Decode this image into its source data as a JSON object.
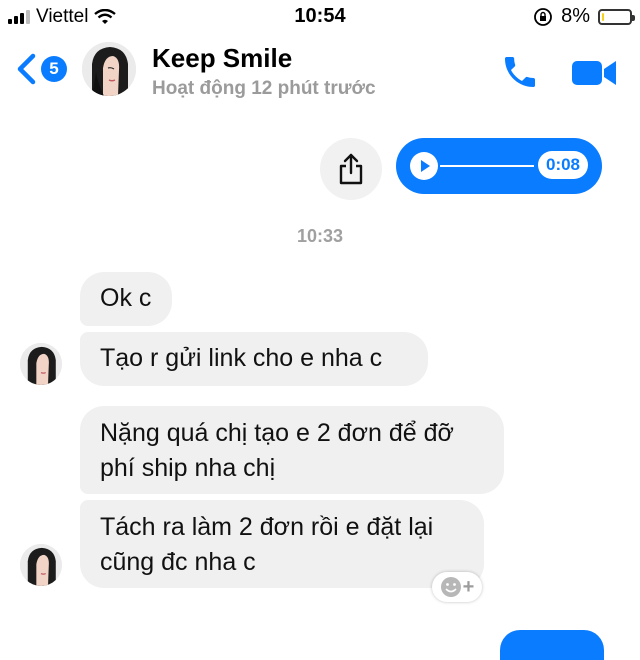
{
  "status_bar": {
    "carrier": "Viettel",
    "time": "10:54",
    "battery": "8%",
    "battery_level": 0.08,
    "icons": [
      "signal-icon",
      "wifi-icon",
      "orientation-lock-icon",
      "battery-icon"
    ]
  },
  "header": {
    "back_count": "5",
    "contact_name": "Keep Smile",
    "contact_status": "Hoạt động 12 phút trước",
    "accent_color": "#0a7cff",
    "icons": [
      "back-chevron-icon",
      "phone-icon",
      "video-camera-icon"
    ]
  },
  "chat": {
    "sent_audio": {
      "duration": "0:08"
    },
    "timestamp": "10:33",
    "messages": [
      {
        "text": "Ok c"
      },
      {
        "text": "Tạo r gửi link cho e nha c"
      },
      {
        "text": "Nặng quá chị tạo e 2 đơn để đỡ phí ship nha chị"
      },
      {
        "text": "Tách ra làm 2 đơn rồi e đặt lại cũng đc nha c"
      }
    ],
    "reaction_plus": "+"
  }
}
